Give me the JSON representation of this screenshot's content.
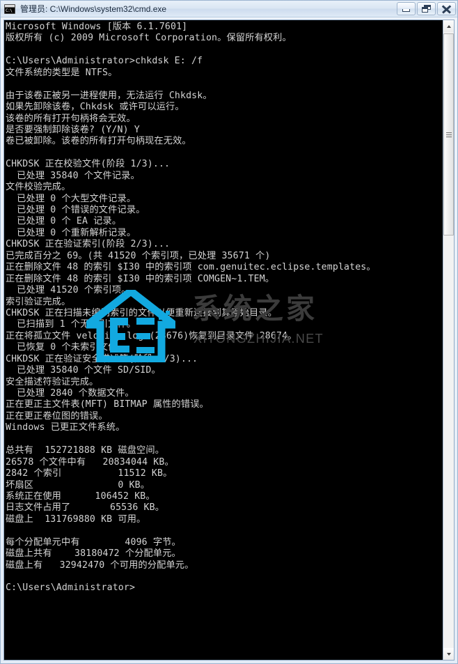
{
  "window": {
    "icon_name": "cmd-icon",
    "icon_text": "C:\\",
    "title": "管理员: C:\\Windows\\system32\\cmd.exe",
    "buttons": {
      "minimize": "最小化",
      "restore": "还原",
      "close": "关闭"
    }
  },
  "console": {
    "background": "#000000",
    "foreground": "#d4d4d4",
    "lines": [
      "Microsoft Windows [版本 6.1.7601]",
      "版权所有 (c) 2009 Microsoft Corporation。保留所有权利。",
      "",
      "C:\\Users\\Administrator>chkdsk E: /f",
      "文件系统的类型是 NTFS。",
      "",
      "由于该卷正被另一进程使用，无法运行 Chkdsk。",
      "如果先卸除该卷，Chkdsk 或许可以运行。",
      "该卷的所有打开句柄将会无效。",
      "是否要强制卸除该卷? (Y/N) Y",
      "卷已被卸除。该卷的所有打开句柄现在无效。",
      "",
      "CHKDSK 正在校验文件(阶段 1/3)...",
      "  已处理 35840 个文件记录。",
      "文件校验完成。",
      "  已处理 0 个大型文件记录。",
      "  已处理 0 个错误的文件记录。",
      "  已处理 0 个 EA 记录。",
      "  已处理 0 个重新解析记录。",
      "CHKDSK 正在验证索引(阶段 2/3)...",
      "已完成百分之 69。(共 41520 个索引项，已处理 35671 个)",
      "正在删除文件 48 的索引 $I30 中的索引项 com.genuitec.eclipse.templates。",
      "正在删除文件 48 的索引 $I30 中的索引项 COMGEN~1.TEM。",
      "  已处理 41520 个索引项。",
      "索引验证完成。",
      "CHKDSK 正在扫描未编制索引的文件以便重新连接到其原始目录。",
      "  已扫描到 1 个无索引文件。",
      "正在将孤立文件 velocity.log (28676)恢复到目录文件 28674。",
      "  已恢复 0 个未索引文件。",
      "CHKDSK 正在验证安全描述符(阶段 3/3)...",
      "  已处理 35840 个文件 SD/SID。",
      "安全描述符验证完成。",
      "  已处理 2840 个数据文件。",
      "正在更正主文件表(MFT) BITMAP 属性的错误。",
      "正在更正卷位图的错误。",
      "Windows 已更正文件系统。",
      "",
      "总共有  152721888 KB 磁盘空间。",
      "26578 个文件中有   20834044 KB。",
      "2842 个索引          11512 KB。",
      "坏扇区               0 KB。",
      "系统正在使用      106452 KB。",
      "日志文件占用了       65536 KB。",
      "磁盘上  131769880 KB 可用。",
      "",
      "每个分配单元中有        4096 字节。",
      "磁盘上共有    38180472 个分配单元。",
      "磁盘上有   32942470 个可用的分配单元。",
      "",
      "C:\\Users\\Administrator>"
    ]
  },
  "watermark": {
    "chinese": "系统之家",
    "english": "XITONGZHIJIA.NET",
    "logo_color": "#12a9e0",
    "text_color": "#3b3b3b"
  },
  "scrollbar": {
    "up_arrow": "scroll-up-icon",
    "down_arrow": "scroll-down-icon",
    "thumb": "scroll-thumb"
  }
}
